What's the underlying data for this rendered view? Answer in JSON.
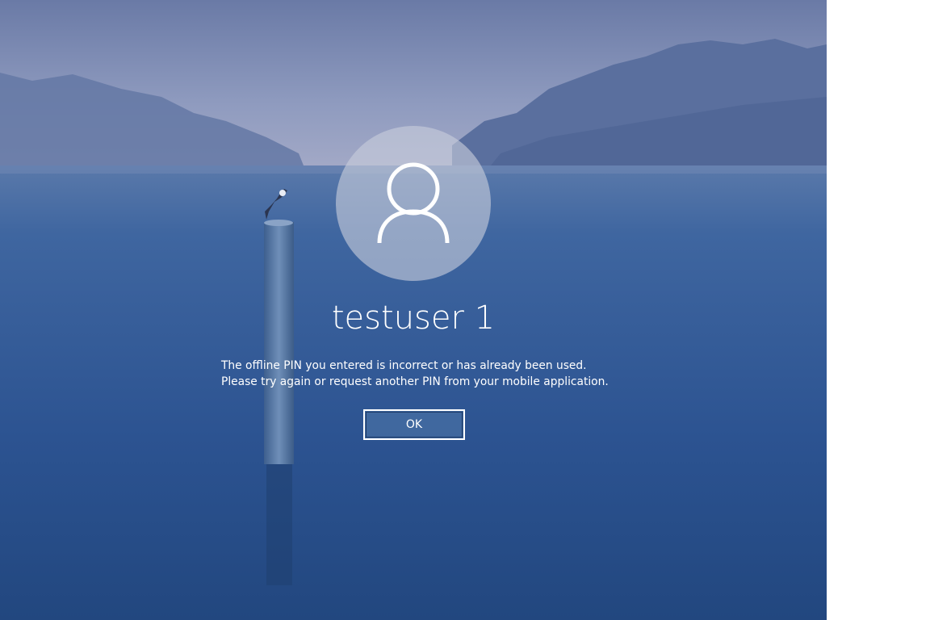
{
  "user": {
    "name": "testuser 1"
  },
  "dialog": {
    "message": "The offline PIN you entered is incorrect or has already been used. Please try again or request another PIN from your mobile application.",
    "ok_label": "OK"
  },
  "icons": {
    "avatar": "user-avatar-icon"
  },
  "colors": {
    "text": "#ffffff",
    "water": "#2a4f86",
    "avatar_circle": "#c8cddc"
  }
}
